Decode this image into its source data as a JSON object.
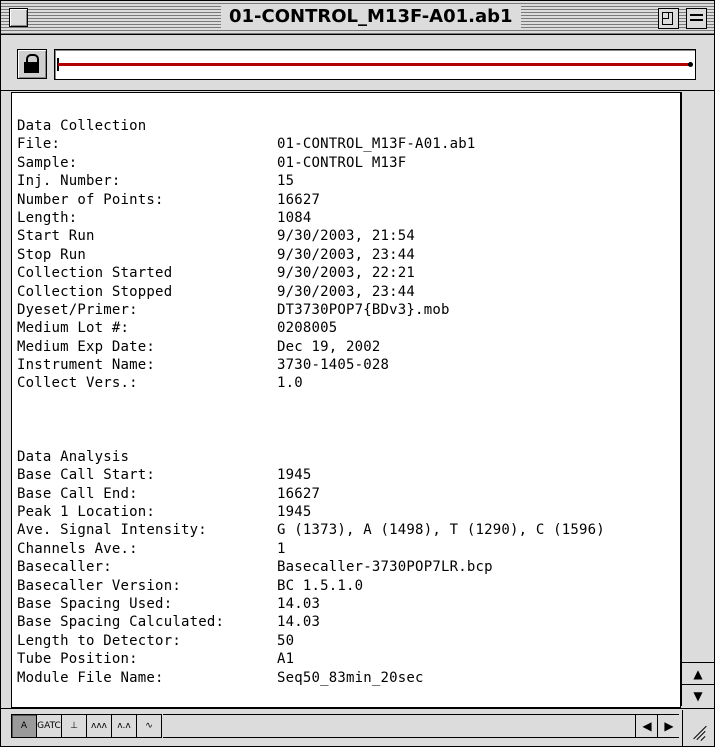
{
  "window": {
    "title": "01-CONTROL_M13F-A01.ab1"
  },
  "icons": {
    "close": "close-box-icon",
    "zoom": "zoom-box-icon",
    "collapse": "collapse-box-icon",
    "lock": "lock-icon",
    "scroll_up": "up-arrow-icon",
    "scroll_down": "down-arrow-icon",
    "scroll_left": "left-arrow-icon",
    "scroll_right": "right-arrow-icon",
    "grow": "resize-grip-icon"
  },
  "colors": {
    "trace": "#b00000"
  },
  "data_collection": {
    "heading": "Data Collection",
    "rows": [
      {
        "label": "File:",
        "value": "01-CONTROL_M13F-A01.ab1"
      },
      {
        "label": "Sample:",
        "value": "01-CONTROL M13F"
      },
      {
        "label": "Inj. Number:",
        "value": "15"
      },
      {
        "label": "Number of Points:",
        "value": "16627"
      },
      {
        "label": "Length:",
        "value": "1084"
      },
      {
        "label": "Start Run",
        "value": "9/30/2003, 21:54"
      },
      {
        "label": "Stop Run",
        "value": "9/30/2003, 23:44"
      },
      {
        "label": "Collection Started",
        "value": "9/30/2003, 22:21"
      },
      {
        "label": "Collection Stopped",
        "value": "9/30/2003, 23:44"
      },
      {
        "label": "Dyeset/Primer:",
        "value": "DT3730POP7{BDv3}.mob"
      },
      {
        "label": "Medium Lot #:",
        "value": "0208005"
      },
      {
        "label": "Medium Exp Date:",
        "value": "Dec 19, 2002"
      },
      {
        "label": "Instrument Name:",
        "value": "3730-1405-028"
      },
      {
        "label": "Collect Vers.:",
        "value": "1.0"
      }
    ]
  },
  "data_analysis": {
    "heading": "Data Analysis",
    "rows": [
      {
        "label": "Base Call Start:",
        "value": "1945"
      },
      {
        "label": "Base Call End:",
        "value": "16627"
      },
      {
        "label": "Peak 1 Location:",
        "value": "1945"
      },
      {
        "label": "Ave. Signal Intensity:",
        "value": "G (1373), A (1498), T (1290), C (1596)"
      },
      {
        "label": "Channels Ave.:",
        "value": "1"
      },
      {
        "label": "Basecaller:",
        "value": "Basecaller-3730POP7LR.bcp"
      },
      {
        "label": "Basecaller Version:",
        "value": "BC 1.5.1.0"
      },
      {
        "label": "Base Spacing Used:",
        "value": "14.03"
      },
      {
        "label": "Base Spacing Calculated:",
        "value": "14.03"
      },
      {
        "label": "Length to Detector:",
        "value": "50"
      },
      {
        "label": "Tube Position:",
        "value": "A1"
      },
      {
        "label": "Module File Name:",
        "value": "Seq50_83min_20sec"
      }
    ]
  },
  "view_buttons": [
    {
      "label": "A",
      "icon": "info-view-icon",
      "active": true
    },
    {
      "label": "GATC",
      "icon": "sequence-view-icon",
      "active": false
    },
    {
      "label": "⊥",
      "icon": "marker-view-icon",
      "active": false
    },
    {
      "label": "ʌʌʌ",
      "icon": "analyzed-trace-icon",
      "active": false
    },
    {
      "label": "ʌ.ʌ",
      "icon": "raw-trace-icon",
      "active": false
    },
    {
      "label": "∿",
      "icon": "signal-view-icon",
      "active": false
    }
  ]
}
